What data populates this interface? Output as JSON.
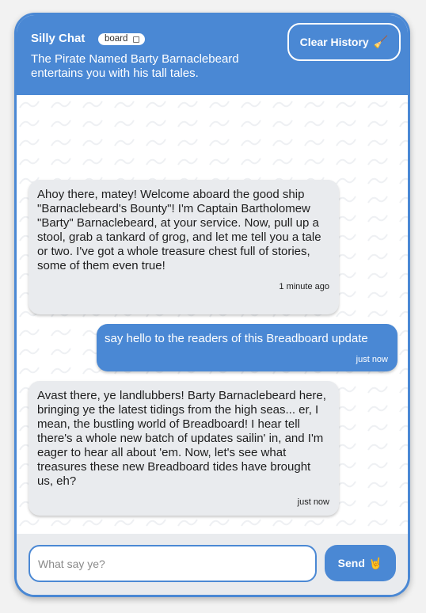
{
  "header": {
    "title": "Silly Chat",
    "badge": "board",
    "badge_icon": "external-link-icon",
    "subtitle": "The Pirate Named Barty Barnaclebeard entertains you with his tall tales.",
    "clear_label": "Clear History",
    "clear_icon": "🧹"
  },
  "messages": [
    {
      "role": "bot",
      "text": "Ahoy there, matey! Welcome aboard the good ship \"Barnaclebeard's Bounty\"! I'm Captain Bartholomew \"Barty\" Barnaclebeard, at your service. Now, pull up a stool, grab a tankard of grog, and let me tell you a tale or two. I've got a whole treasure chest full of stories, some of them even true!",
      "time": "1 minute ago"
    },
    {
      "role": "user",
      "text": "say hello to the readers of this Breadboard update",
      "time": "just now"
    },
    {
      "role": "bot",
      "text": "Avast there, ye landlubbers! Barty Barnaclebeard here, bringing ye the latest tidings from the high seas... er, I mean, the bustling world of Breadboard! I hear tell there's a whole new batch of updates sailin' in, and I'm eager to hear all about 'em. Now, let's see what treasures these new Breadboard tides have brought us, eh?",
      "time": "just now"
    }
  ],
  "composer": {
    "placeholder": "What say ye?",
    "value": "",
    "send_label": "Send",
    "send_icon": "🤘"
  },
  "colors": {
    "accent": "#4a88d4",
    "bot_bubble": "#e9ebee"
  }
}
